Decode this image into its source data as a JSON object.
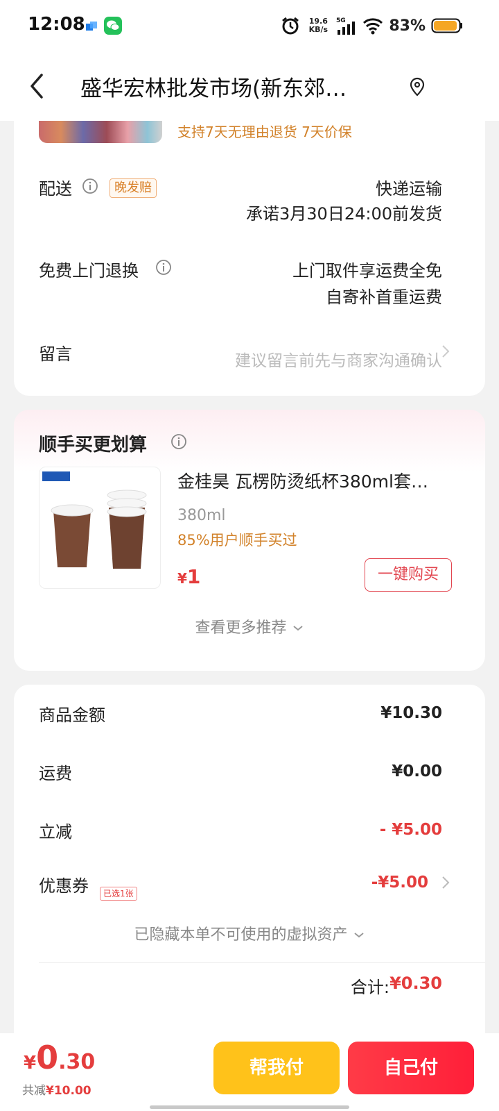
{
  "status_bar": {
    "time": "12:08",
    "net_speed_value": "19.6",
    "net_speed_unit": "KB/s",
    "network_label": "5G",
    "battery_percent": "83%",
    "icons": [
      "app-blue-icon",
      "wechat-icon",
      "alarm-icon",
      "signal-icon",
      "wifi-icon",
      "battery-icon"
    ]
  },
  "header": {
    "title": "盛华宏林批发市场(新东郊…",
    "icons": [
      "back-icon",
      "location-icon"
    ]
  },
  "delivery_card": {
    "guarantee_text": "支持7天无理由退货  7天价保",
    "delivery": {
      "label": "配送",
      "tag": "晚发赔",
      "method": "快递运输",
      "promise": "承诺3月30日24:00前发货"
    },
    "free_return": {
      "label": "免费上门退换",
      "line1": "上门取件享运费全免",
      "line2": "自寄补首重运费"
    },
    "message": {
      "label": "留言",
      "placeholder": "建议留言前先与商家沟通确认"
    }
  },
  "recommend_card": {
    "title": "顺手买更划算",
    "product": {
      "name": "金桂昊 瓦楞防烫纸杯380ml套…",
      "spec": "380ml",
      "social_proof": "85%用户顺手买过",
      "price_currency": "¥",
      "price": "1",
      "buy_button": "一键购买"
    },
    "see_more": "查看更多推荐"
  },
  "summary_card": {
    "rows": [
      {
        "label": "商品金额",
        "value": "¥10.30"
      },
      {
        "label": "运费",
        "value": "¥0.00"
      },
      {
        "label": "立减",
        "value": "- ¥5.00"
      },
      {
        "label": "优惠券",
        "value": "-¥5.00",
        "tag": "已选1张"
      }
    ],
    "hidden_assets": "已隐藏本单不可使用的虚拟资产",
    "total_label": "合计:",
    "total_value": "¥0.30"
  },
  "bottom_bar": {
    "currency": "¥",
    "amount_int": "0",
    "amount_dec": ".30",
    "saved_prefix": "共减",
    "saved_value": "¥10.00",
    "help_pay_button": "帮我付",
    "self_pay_button": "自己付"
  },
  "colors": {
    "accent_red": "#e43d3d",
    "accent_orange": "#d2822a",
    "help_button": "#ffc21a",
    "pay_button": "#ff2a3f"
  }
}
